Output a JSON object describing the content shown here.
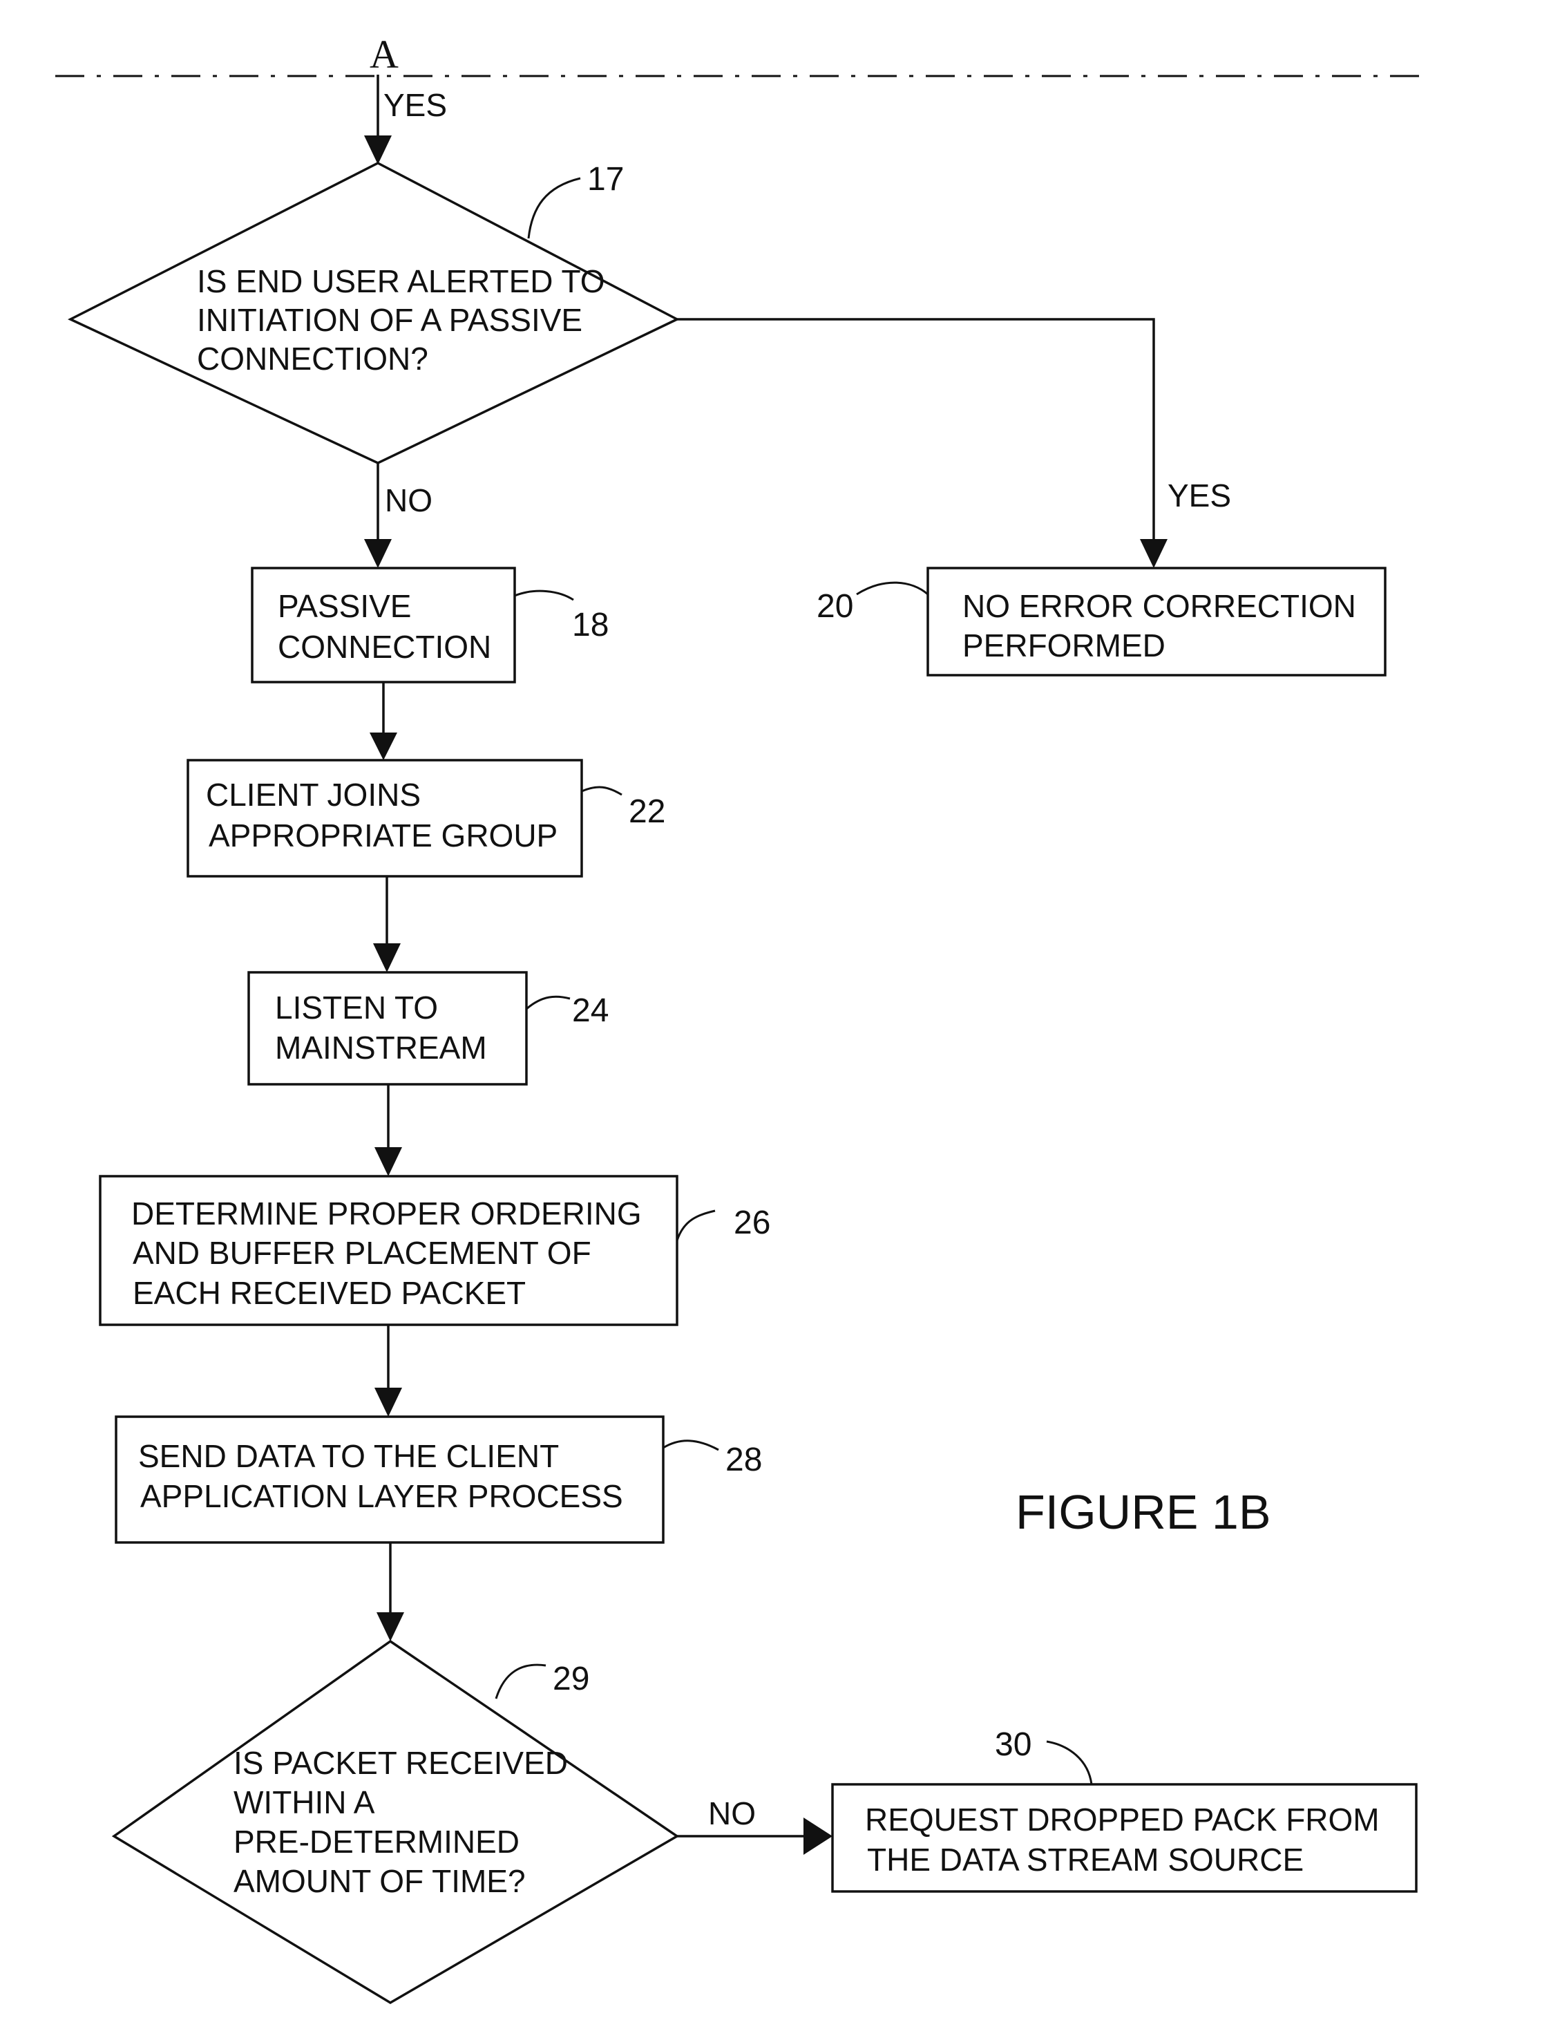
{
  "figure_label": "FIGURE 1B",
  "connector": {
    "label": "A"
  },
  "nodes": {
    "decision_alert": {
      "ref": "17",
      "lines": [
        "IS END USER ALERTED TO",
        "INITIATION OF A PASSIVE",
        "CONNECTION?"
      ]
    },
    "no_error_correction": {
      "ref": "20",
      "lines": [
        "NO ERROR CORRECTION",
        "PERFORMED"
      ]
    },
    "passive_connection": {
      "ref": "18",
      "lines": [
        "PASSIVE",
        "CONNECTION"
      ]
    },
    "client_joins": {
      "ref": "22",
      "lines": [
        "CLIENT JOINS",
        "APPROPRIATE GROUP"
      ]
    },
    "listen_mainstream": {
      "ref": "24",
      "lines": [
        "LISTEN TO",
        "MAINSTREAM"
      ]
    },
    "determine_ordering": {
      "ref": "26",
      "lines": [
        "DETERMINE PROPER ORDERING",
        "AND BUFFER PLACEMENT OF",
        "EACH RECEIVED PACKET"
      ]
    },
    "send_data": {
      "ref": "28",
      "lines": [
        "SEND DATA TO THE CLIENT",
        "APPLICATION LAYER PROCESS"
      ]
    },
    "decision_packet": {
      "ref": "29",
      "lines": [
        "IS PACKET RECEIVED",
        "WITHIN A",
        "PRE-DETERMINED",
        "AMOUNT OF TIME?"
      ]
    },
    "request_dropped": {
      "ref": "30",
      "lines": [
        "REQUEST DROPPED PACK FROM",
        "THE DATA STREAM SOURCE"
      ]
    }
  },
  "edge_labels": {
    "connector_to_alert": "YES",
    "alert_no": "NO",
    "alert_yes": "YES",
    "packet_no": "NO"
  }
}
